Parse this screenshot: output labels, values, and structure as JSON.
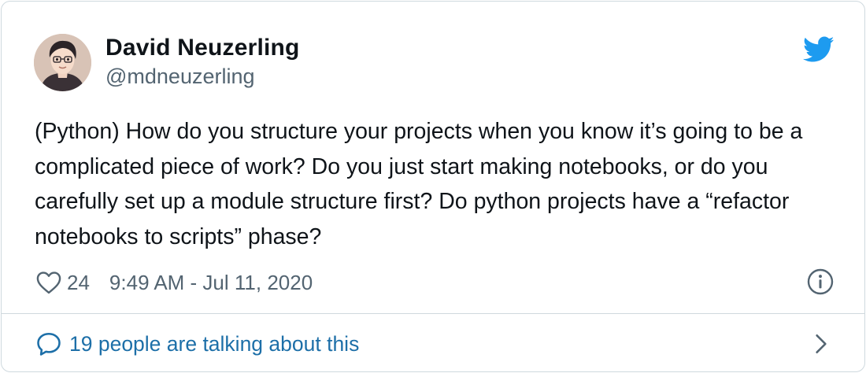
{
  "author": {
    "display_name": "David Neuzerling",
    "handle": "@mdneuzerling",
    "avatar_icon": "user-avatar"
  },
  "tweet": {
    "text": "(Python) How do you structure your projects when you know it’s going to be a complicated piece of work? Do you just start making notebooks, or do you carefully set up a module structure first? Do python projects have a “refactor notebooks to scripts” phase?",
    "like_count": "24",
    "timestamp": "9:49 AM - Jul 11, 2020"
  },
  "footer": {
    "conversation_label": "19 people are talking about this"
  },
  "icons": {
    "brand": "twitter-bird-icon",
    "like": "heart-icon",
    "info": "info-icon",
    "conversation": "speech-bubble-icon",
    "more": "chevron-right-icon"
  },
  "colors": {
    "brand_blue": "#1d9bf0",
    "text_primary": "#0f1419",
    "text_secondary": "#536471",
    "link_blue": "#1d6fa8",
    "border": "#cfd9de"
  }
}
